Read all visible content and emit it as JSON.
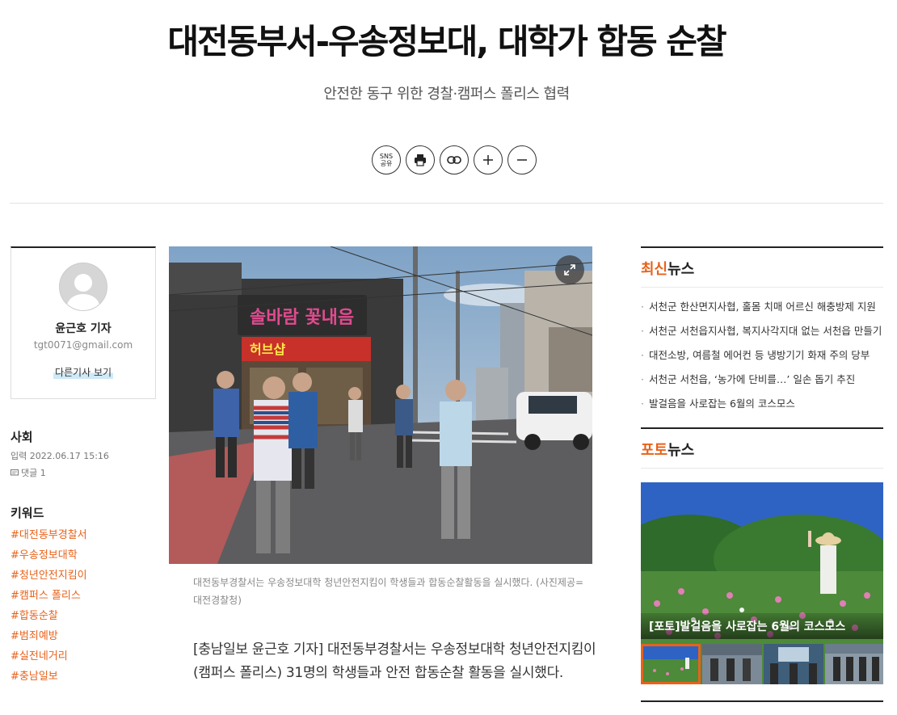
{
  "article": {
    "headline": "대전동부서-우송정보대, 대학가 합동 순찰",
    "subheadline": "안전한 동구 위한 경찰·캠퍼스 폴리스 협력",
    "photo_caption": "대전동부경찰서는 우송정보대학 청년안전지킴이 학생들과 합동순찰활동을 실시했다. (사진제공=대전경찰청)",
    "body_text": "[충남일보 윤근호 기자] 대전동부경찰서는 우송정보대학 청년안전지킴이(캠퍼스 폴리스) 31명의 학생들과 안전 합동순찰 활동을 실시했다."
  },
  "tools": {
    "sns_label_1": "SNS",
    "sns_label_2": "공유",
    "items": [
      "sns-share",
      "print",
      "link",
      "font-increase",
      "font-decrease"
    ]
  },
  "reporter": {
    "name": "윤근호 기자",
    "email": "tgt0071@gmail.com",
    "more_link": "다른기사 보기"
  },
  "meta": {
    "section": "사회",
    "date": "입력 2022.06.17 15:16",
    "comments": "댓글 1"
  },
  "keywords": {
    "title": "키워드",
    "items": [
      "#대전동부경찰서",
      "#우송정보대학",
      "#청년안전지킴이",
      "#캠퍼스 폴리스",
      "#합동순찰",
      "#범죄예방",
      "#실전네거리",
      "#충남일보"
    ]
  },
  "latest_news": {
    "title_accent": "최신",
    "title_rest": "뉴스",
    "items": [
      "서천군 한산면지사협, 홀몸 치매 어르신 해충방제 지원",
      "서천군 서천읍지사협, 복지사각지대 없는 서천읍 만들기",
      "대전소방, 여름철 에어컨 등 냉방기기 화재 주의 당부",
      "서천군 서천읍, ‘농가에 단비를…’ 일손 돕기 추진",
      "발걸음을 사로잡는 6월의 코스모스"
    ]
  },
  "photo_news": {
    "title_accent": "포토",
    "title_rest": "뉴스",
    "caption": "[포토]발걸음을 사로잡는 6월의 코스모스"
  },
  "colors": {
    "accent": "#e8621a",
    "link_highlight": "#cfe9f7"
  },
  "photo_signs": {
    "cafe_sign": "솔바람 꽃내음",
    "shop_sign": "허브샵"
  }
}
